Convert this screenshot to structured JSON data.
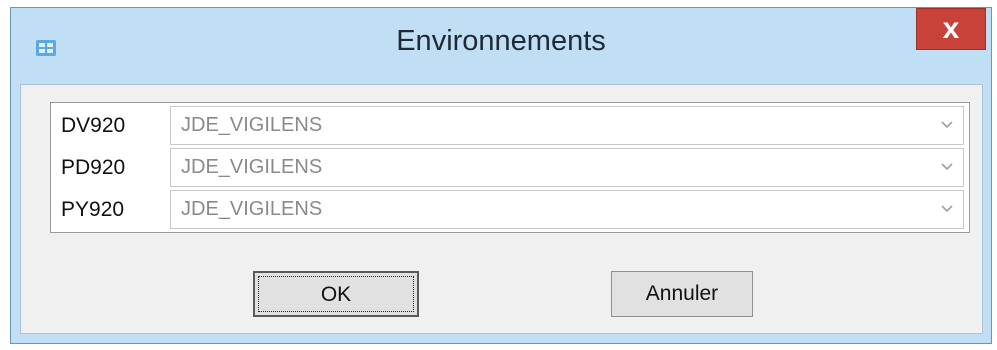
{
  "window": {
    "title": "Environnements",
    "close_label": "x"
  },
  "environments": [
    {
      "name": "DV920",
      "value": "JDE_VIGILENS"
    },
    {
      "name": "PD920",
      "value": "JDE_VIGILENS"
    },
    {
      "name": "PY920",
      "value": "JDE_VIGILENS"
    }
  ],
  "buttons": {
    "ok_label": "OK",
    "cancel_label": "Annuler"
  },
  "icons": {
    "app": "window-app-icon",
    "close": "close-icon",
    "dropdown": "chevron-down-icon"
  },
  "colors": {
    "titlebar_bg": "#c1dff4",
    "close_button_bg": "#c9423a",
    "dialog_bg": "#f0f0f0",
    "select_text": "#8a8a8a"
  }
}
